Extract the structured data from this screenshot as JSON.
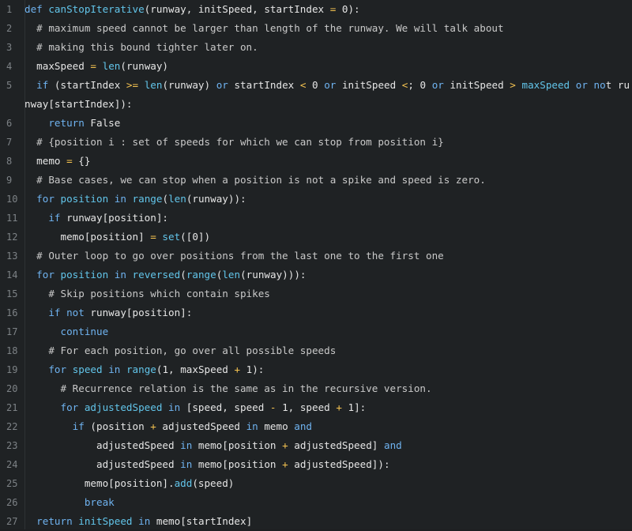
{
  "colors": {
    "background": "#1f2224",
    "line_number": "#7d8286",
    "keyword": "#6fb3f0",
    "function": "#62c5ea",
    "operator": "#f5c350",
    "text": "#e6e6e6"
  },
  "lines": [
    {
      "n": "1",
      "tokens": [
        [
          "kw",
          "def"
        ],
        [
          "sp",
          " "
        ],
        [
          "fn",
          "canStopIterative"
        ],
        [
          "pu",
          "(runway, initSpeed, startIndex "
        ],
        [
          "op",
          "="
        ],
        [
          "pu",
          " 0):"
        ]
      ]
    },
    {
      "n": "2",
      "tokens": [
        [
          "sp",
          "  "
        ],
        [
          "cmt",
          "# maximum speed cannot be larger than length of the runway. We will talk about"
        ]
      ]
    },
    {
      "n": "3",
      "tokens": [
        [
          "sp",
          "  "
        ],
        [
          "cmt",
          "# making this bound tighter later on."
        ]
      ]
    },
    {
      "n": "4",
      "tokens": [
        [
          "sp",
          "  "
        ],
        [
          "id",
          "maxSpeed "
        ],
        [
          "op",
          "="
        ],
        [
          "pu",
          " "
        ],
        [
          "fn",
          "len"
        ],
        [
          "pu",
          "(runway)"
        ]
      ]
    },
    {
      "n": "5",
      "wrap": true,
      "tokens": [
        [
          "sp",
          "  "
        ],
        [
          "kw",
          "if"
        ],
        [
          "pu",
          " (startIndex "
        ],
        [
          "op",
          ">="
        ],
        [
          "pu",
          " "
        ],
        [
          "fn",
          "len"
        ],
        [
          "pu",
          "(runway) "
        ],
        [
          "kw",
          "or"
        ],
        [
          "pu",
          " startIndex "
        ],
        [
          "op",
          "<"
        ],
        [
          "pu",
          " 0 "
        ],
        [
          "kw",
          "or"
        ],
        [
          "pu",
          " initSpeed "
        ],
        [
          "op",
          "<"
        ],
        [
          "pu",
          "; 0 "
        ],
        [
          "kw",
          "or"
        ],
        [
          "pu",
          " initSpeed "
        ],
        [
          "op",
          ">"
        ],
        [
          "pu",
          " "
        ],
        [
          "fn",
          "maxSpeed"
        ],
        [
          "pu",
          " "
        ],
        [
          "kw",
          "or"
        ],
        [
          "pu",
          " "
        ],
        [
          "kw",
          "no"
        ],
        [
          "pu",
          "t"
        ],
        [
          "pu",
          " runway[startIndex]):"
        ]
      ]
    },
    {
      "n": "6",
      "tokens": [
        [
          "sp",
          "    "
        ],
        [
          "kw",
          "return"
        ],
        [
          "pu",
          " False"
        ]
      ]
    },
    {
      "n": "7",
      "tokens": [
        [
          "sp",
          "  "
        ],
        [
          "cmt",
          "# {position i : set of speeds for which we can stop from position i}"
        ]
      ]
    },
    {
      "n": "8",
      "tokens": [
        [
          "sp",
          "  "
        ],
        [
          "id",
          "memo "
        ],
        [
          "op",
          "="
        ],
        [
          "pu",
          " {}"
        ]
      ]
    },
    {
      "n": "9",
      "tokens": [
        [
          "sp",
          "  "
        ],
        [
          "cmt",
          "# Base cases, we can stop when a position is not a spike and speed is zero."
        ]
      ]
    },
    {
      "n": "10",
      "tokens": [
        [
          "sp",
          "  "
        ],
        [
          "kw",
          "for"
        ],
        [
          "pu",
          " "
        ],
        [
          "fn",
          "position"
        ],
        [
          "pu",
          " "
        ],
        [
          "kw",
          "in"
        ],
        [
          "pu",
          " "
        ],
        [
          "fn",
          "range"
        ],
        [
          "pu",
          "("
        ],
        [
          "fn",
          "len"
        ],
        [
          "pu",
          "(runway)):"
        ]
      ]
    },
    {
      "n": "11",
      "tokens": [
        [
          "sp",
          "    "
        ],
        [
          "kw",
          "if"
        ],
        [
          "pu",
          " runway[position]:"
        ]
      ]
    },
    {
      "n": "12",
      "tokens": [
        [
          "sp",
          "      "
        ],
        [
          "id",
          "memo[position] "
        ],
        [
          "op",
          "="
        ],
        [
          "pu",
          " "
        ],
        [
          "fn",
          "set"
        ],
        [
          "pu",
          "([0])"
        ]
      ]
    },
    {
      "n": "13",
      "tokens": [
        [
          "sp",
          "  "
        ],
        [
          "cmt",
          "# Outer loop to go over positions from the last one to the first one"
        ]
      ]
    },
    {
      "n": "14",
      "tokens": [
        [
          "sp",
          "  "
        ],
        [
          "kw",
          "for"
        ],
        [
          "pu",
          " "
        ],
        [
          "fn",
          "position"
        ],
        [
          "pu",
          " "
        ],
        [
          "kw",
          "in"
        ],
        [
          "pu",
          " "
        ],
        [
          "fn",
          "reversed"
        ],
        [
          "pu",
          "("
        ],
        [
          "fn",
          "range"
        ],
        [
          "pu",
          "("
        ],
        [
          "fn",
          "len"
        ],
        [
          "pu",
          "(runway))):"
        ]
      ]
    },
    {
      "n": "15",
      "tokens": [
        [
          "sp",
          "    "
        ],
        [
          "cmt",
          "# Skip positions which contain spikes"
        ]
      ]
    },
    {
      "n": "16",
      "tokens": [
        [
          "sp",
          "    "
        ],
        [
          "kw",
          "if not"
        ],
        [
          "pu",
          " runway[position]:"
        ]
      ]
    },
    {
      "n": "17",
      "tokens": [
        [
          "sp",
          "      "
        ],
        [
          "kw",
          "continue"
        ]
      ]
    },
    {
      "n": "18",
      "tokens": [
        [
          "sp",
          "    "
        ],
        [
          "cmt",
          "# For each position, go over all possible speeds"
        ]
      ]
    },
    {
      "n": "19",
      "tokens": [
        [
          "sp",
          "    "
        ],
        [
          "kw",
          "for"
        ],
        [
          "pu",
          " "
        ],
        [
          "fn",
          "speed"
        ],
        [
          "pu",
          " "
        ],
        [
          "kw",
          "in"
        ],
        [
          "pu",
          " "
        ],
        [
          "fn",
          "range"
        ],
        [
          "pu",
          "(1, maxSpeed "
        ],
        [
          "op",
          "+"
        ],
        [
          "pu",
          " 1):"
        ]
      ]
    },
    {
      "n": "20",
      "tokens": [
        [
          "sp",
          "      "
        ],
        [
          "cmt",
          "# Recurrence relation is the same as in the recursive version."
        ]
      ]
    },
    {
      "n": "21",
      "tokens": [
        [
          "sp",
          "      "
        ],
        [
          "kw",
          "for"
        ],
        [
          "pu",
          " "
        ],
        [
          "fn",
          "adjustedSpeed"
        ],
        [
          "pu",
          " "
        ],
        [
          "kw",
          "in"
        ],
        [
          "pu",
          " [speed, speed "
        ],
        [
          "op",
          "-"
        ],
        [
          "pu",
          " 1, speed "
        ],
        [
          "op",
          "+"
        ],
        [
          "pu",
          " 1]:"
        ]
      ]
    },
    {
      "n": "22",
      "tokens": [
        [
          "sp",
          "        "
        ],
        [
          "kw",
          "if"
        ],
        [
          "pu",
          " (position "
        ],
        [
          "op",
          "+"
        ],
        [
          "pu",
          " adjustedSpeed "
        ],
        [
          "kw",
          "in"
        ],
        [
          "pu",
          " memo "
        ],
        [
          "kw",
          "and"
        ]
      ]
    },
    {
      "n": "23",
      "tokens": [
        [
          "sp",
          "            "
        ],
        [
          "id",
          "adjustedSpeed "
        ],
        [
          "kw",
          "in"
        ],
        [
          "pu",
          " memo[position "
        ],
        [
          "op",
          "+"
        ],
        [
          "pu",
          " adjustedSpeed] "
        ],
        [
          "kw",
          "and"
        ]
      ]
    },
    {
      "n": "24",
      "tokens": [
        [
          "sp",
          "            "
        ],
        [
          "id",
          "adjustedSpeed "
        ],
        [
          "kw",
          "in"
        ],
        [
          "pu",
          " memo[position "
        ],
        [
          "op",
          "+"
        ],
        [
          "pu",
          " adjustedSpeed]):"
        ]
      ]
    },
    {
      "n": "25",
      "tokens": [
        [
          "sp",
          "          "
        ],
        [
          "id",
          "memo[position]."
        ],
        [
          "fn",
          "add"
        ],
        [
          "pu",
          "(speed)"
        ]
      ]
    },
    {
      "n": "26",
      "tokens": [
        [
          "sp",
          "          "
        ],
        [
          "kw",
          "break"
        ]
      ]
    },
    {
      "n": "27",
      "tokens": [
        [
          "sp",
          "  "
        ],
        [
          "kw",
          "return"
        ],
        [
          "pu",
          " "
        ],
        [
          "fn",
          "initSpeed"
        ],
        [
          "pu",
          " "
        ],
        [
          "kw",
          "in"
        ],
        [
          "pu",
          " memo[startIndex]"
        ]
      ]
    }
  ]
}
